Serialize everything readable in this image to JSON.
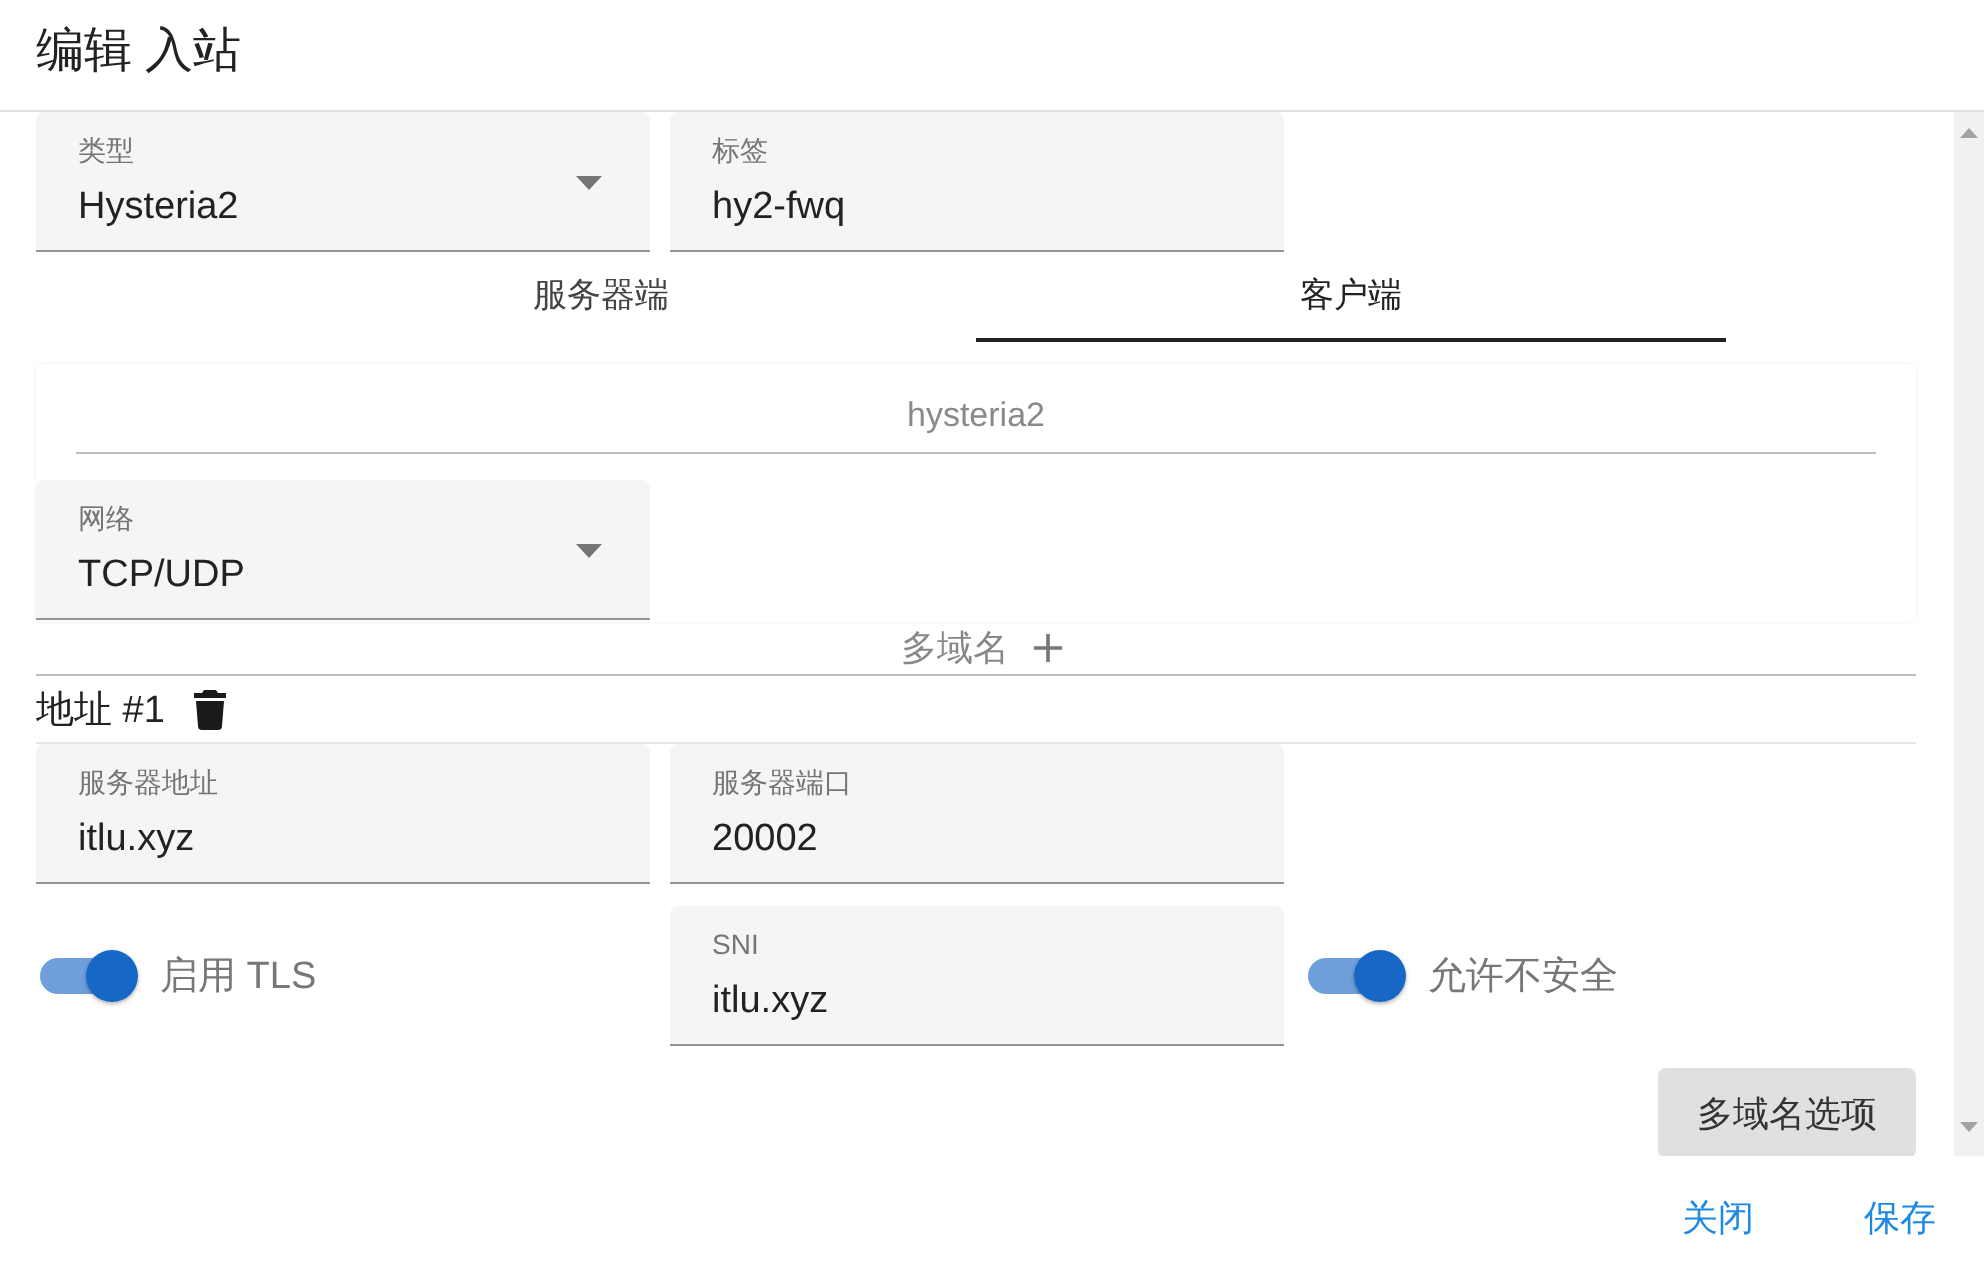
{
  "dialog": {
    "title": "编辑 入站"
  },
  "top_fields": [
    {
      "kind": "select",
      "label": "类型",
      "value": "Hysteria2"
    },
    {
      "kind": "text",
      "label": "标签",
      "value": "hy2-fwq"
    }
  ],
  "tabs": [
    {
      "label": "服务器端",
      "selected": false
    },
    {
      "label": "客户端",
      "selected": true
    }
  ],
  "protocol_field": {
    "value": "hysteria2",
    "disabled": true
  },
  "network_field": {
    "kind": "select",
    "label": "网络",
    "value": "TCP/UDP"
  },
  "multi_domain": {
    "label": "多域名"
  },
  "address": {
    "title": "地址 #1",
    "fields": [
      {
        "kind": "text",
        "label": "服务器地址",
        "value": "itlu.xyz"
      },
      {
        "kind": "text",
        "label": "服务器端口",
        "value": "20002"
      }
    ]
  },
  "tls_row": [
    {
      "kind": "switch",
      "label": "启用 TLS",
      "on": true
    },
    {
      "kind": "text",
      "label": "SNI",
      "value": "itlu.xyz"
    },
    {
      "kind": "switch",
      "label": "允许不安全",
      "on": true
    }
  ],
  "options_button": {
    "label": "多域名选项"
  },
  "actions": [
    {
      "label": "关闭"
    },
    {
      "label": "保存"
    }
  ]
}
